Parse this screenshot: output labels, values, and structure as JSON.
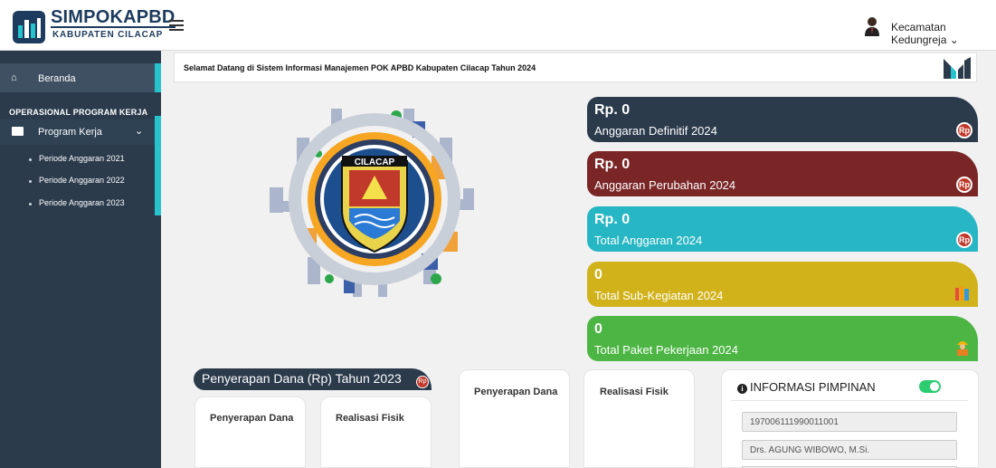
{
  "brand": {
    "title": "SIMPOKAPBD",
    "subtitle": "KABUPATEN CILACAP"
  },
  "header": {
    "user_name": "Kecamatan Kedungreja ⌄"
  },
  "sidebar": {
    "home": {
      "icon": "home-icon",
      "label": "Beranda"
    },
    "section_title": "OPERASIONAL PROGRAM KERJA",
    "group": {
      "icon": "folder-icon",
      "label": "Program Kerja"
    },
    "items": [
      {
        "label": "Periode Anggaran 2021"
      },
      {
        "label": "Periode Anggaran 2022"
      },
      {
        "label": "Periode Anggaran 2023"
      }
    ]
  },
  "welcome": {
    "text": "Selamat Datang di Sistem Informasi Manajemen POK APBD Kabupaten Cilacap Tahun 2024"
  },
  "emblem": {
    "banner": "CILACAP"
  },
  "cards": [
    {
      "value": "Rp. 0",
      "label": "Anggaran Definitif 2024",
      "color": "#2b3b4c",
      "icon": "rupiah-icon",
      "badge": "Rp"
    },
    {
      "value": "Rp. 0",
      "label": "Anggaran Perubahan 2024",
      "color": "#7a2626",
      "icon": "rupiah-icon",
      "badge": "Rp"
    },
    {
      "value": "Rp. 0",
      "label": "Total Anggaran 2024",
      "color": "#27b6c3",
      "icon": "rupiah-icon",
      "badge": "Rp"
    },
    {
      "value": "0",
      "label": "Total Sub-Kegiatan 2024",
      "color": "#d1b21b",
      "icon": "books-icon"
    },
    {
      "value": "0",
      "label": "Total Paket Pekerjaan 2024",
      "color": "#4cb544",
      "icon": "worker-icon"
    }
  ],
  "penyerapan": {
    "title": "Penyerapan Dana (Rp) Tahun 2023",
    "badge": "Rp",
    "panel_left_label": "Penyerapan Dana",
    "panel_right_label": "Realisasi Fisik",
    "panel_mid_label": "Penyerapan Dana",
    "panel_mid2_label": "Realisasi Fisik"
  },
  "info": {
    "title": "INFORMASI PIMPINAN",
    "toggle_on": true,
    "nip": "197006111990011001",
    "name": "Drs. AGUNG WIBOWO, M.Si."
  },
  "colors": {
    "accent": "#27c3cc",
    "sidebar": "#2b3b4c"
  }
}
